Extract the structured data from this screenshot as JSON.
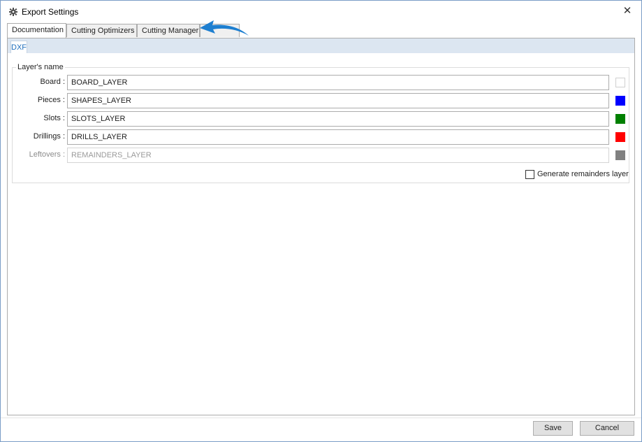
{
  "window": {
    "title": "Export Settings",
    "close_glyph": "✕",
    "icon": "gear-icon"
  },
  "tabs": [
    {
      "label": "Documentation",
      "active": true
    },
    {
      "label": "Cutting Optimizers",
      "active": false
    },
    {
      "label": "Cutting Manager",
      "active": false
    }
  ],
  "subtabs": [
    {
      "label": "DXF",
      "active": true
    }
  ],
  "layers_group": {
    "title": "Layer's name",
    "rows": [
      {
        "label": "Board :",
        "value": "BOARD_LAYER",
        "color": "#ffffff",
        "enabled": true
      },
      {
        "label": "Pieces :",
        "value": "SHAPES_LAYER",
        "color": "#0000ff",
        "enabled": true
      },
      {
        "label": "Slots :",
        "value": "SLOTS_LAYER",
        "color": "#008000",
        "enabled": true
      },
      {
        "label": "Drillings :",
        "value": "DRILLS_LAYER",
        "color": "#ff0000",
        "enabled": true
      },
      {
        "label": "Leftovers :",
        "value": "REMAINDERS_LAYER",
        "color": "#808080",
        "enabled": false
      }
    ],
    "generate_remainders": {
      "label": "Generate remainders layer",
      "checked": false
    }
  },
  "footer": {
    "save_label": "Save",
    "cancel_label": "Cancel"
  },
  "annotation": {
    "icon": "curved-arrow-icon",
    "color": "#1e7fd0"
  }
}
